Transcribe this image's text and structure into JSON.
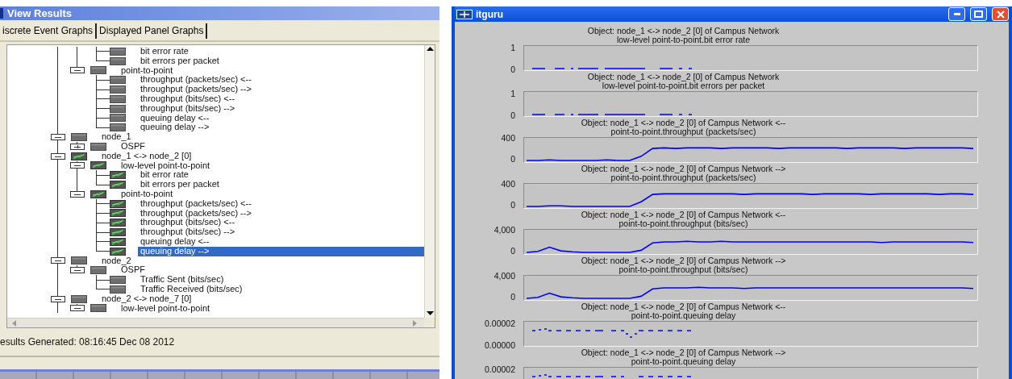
{
  "results_window": {
    "title": "View Results"
  },
  "tabs": [
    {
      "label": "iscrete Event Graphs"
    },
    {
      "label": "Displayed Panel Graphs"
    }
  ],
  "tree": {
    "items": [
      {
        "children": [
          {
            "children": [
              {
                "label": "bit error rate",
                "plotted": false,
                "selected": false
              },
              {
                "label": "bit errors per packet",
                "plotted": false,
                "selected": false
              }
            ]
          },
          {
            "label": "point-to-point",
            "expanded": true,
            "plotted": false,
            "selected": false,
            "children": [
              {
                "label": "throughput (packets/sec) <--",
                "plotted": false,
                "selected": false
              },
              {
                "label": "throughput (packets/sec) -->",
                "plotted": false,
                "selected": false
              },
              {
                "label": "throughput (bits/sec) <--",
                "plotted": false,
                "selected": false
              },
              {
                "label": "throughput (bits/sec) -->",
                "plotted": false,
                "selected": false
              },
              {
                "label": "queuing delay <--",
                "plotted": false,
                "selected": false
              },
              {
                "label": "queuing delay -->",
                "plotted": false,
                "selected": false
              }
            ]
          }
        ]
      },
      {
        "label": "node_1",
        "expanded": true,
        "plotted": false,
        "selected": false,
        "children": [
          {
            "label": "OSPF",
            "expanded": false,
            "plotted": false,
            "selected": false
          }
        ]
      },
      {
        "label": "node_1 <-> node_2 [0]",
        "expanded": true,
        "plotted": true,
        "selected": false,
        "children": [
          {
            "label": "low-level point-to-point",
            "expanded": true,
            "plotted": true,
            "selected": false,
            "children": [
              {
                "label": "bit error rate",
                "plotted": true,
                "selected": false
              },
              {
                "label": "bit errors per packet",
                "plotted": true,
                "selected": false
              }
            ]
          },
          {
            "label": "point-to-point",
            "expanded": true,
            "plotted": true,
            "selected": false,
            "children": [
              {
                "label": "throughput (packets/sec) <--",
                "plotted": true,
                "selected": false
              },
              {
                "label": "throughput (packets/sec) -->",
                "plotted": true,
                "selected": false
              },
              {
                "label": "throughput (bits/sec) <--",
                "plotted": true,
                "selected": false
              },
              {
                "label": "throughput (bits/sec) -->",
                "plotted": true,
                "selected": false
              },
              {
                "label": "queuing delay <--",
                "plotted": true,
                "selected": false
              },
              {
                "label": "queuing delay -->",
                "plotted": true,
                "selected": true
              }
            ]
          }
        ]
      },
      {
        "label": "node_2",
        "expanded": true,
        "plotted": false,
        "selected": false,
        "children": [
          {
            "label": "OSPF",
            "expanded": true,
            "plotted": false,
            "selected": false,
            "children": [
              {
                "label": "Traffic Sent (bits/sec)",
                "plotted": false,
                "selected": false
              },
              {
                "label": "Traffic Received (bits/sec)",
                "plotted": false,
                "selected": false
              }
            ]
          }
        ]
      },
      {
        "label": "node_2 <-> node_7 [0]",
        "expanded": true,
        "plotted": false,
        "selected": false,
        "children": [
          {
            "label": "low-level point-to-point",
            "expanded": true,
            "plotted": false,
            "selected": false
          }
        ]
      }
    ]
  },
  "status": "esults Generated: 08:16:45 Dec 08 2012",
  "graph_window": {
    "title": "itguru"
  },
  "graphs": [
    {
      "kind": "flat",
      "object_line": "Object: node_1 <-> node_2 [0] of Campus Network",
      "stat_line": "low-level point-to-point.bit error rate",
      "axis_labels": [
        "1",
        "0"
      ]
    },
    {
      "kind": "flat",
      "object_line": "Object: node_1 <-> node_2 [0] of Campus Network",
      "stat_line": "low-level point-to-point.bit errors per packet",
      "axis_labels": [
        "1",
        "0"
      ]
    },
    {
      "kind": "chart",
      "object_line": "Object: node_1 <-> node_2 [0] of Campus Network <--",
      "stat_line": "point-to-point.throughput (packets/sec)",
      "chart_data": {
        "type": "line",
        "ylim": [
          -46,
          446
        ],
        "yticks": [
          {
            "value": 400,
            "label": "400"
          },
          {
            "value": 0,
            "label": "0"
          }
        ],
        "series": [
          {
            "color": "#0000ff",
            "values": [
              0,
              0,
              10,
              0,
              0,
              0,
              0,
              10,
              0,
              0,
              80,
              230,
              240,
              230,
              240,
              240,
              240,
              230,
              240,
              240,
              240,
              240,
              230,
              240,
              240,
              240,
              240,
              240,
              230,
              240,
              240,
              240,
              240,
              230,
              240,
              240,
              240,
              240,
              240,
              230
            ]
          }
        ]
      }
    },
    {
      "kind": "chart",
      "object_line": "Object: node_1 <-> node_2 [0] of Campus Network -->",
      "stat_line": "point-to-point.throughput (packets/sec)",
      "chart_data": {
        "type": "line",
        "ylim": [
          -46,
          446
        ],
        "yticks": [
          {
            "value": 400,
            "label": "400"
          },
          {
            "value": 0,
            "label": "0"
          }
        ],
        "series": [
          {
            "color": "#0000ff",
            "values": [
              0,
              0,
              10,
              10,
              0,
              0,
              0,
              0,
              0,
              0,
              90,
              230,
              240,
              240,
              240,
              240,
              240,
              240,
              240,
              230,
              240,
              240,
              240,
              240,
              240,
              230,
              240,
              240,
              240,
              240,
              230,
              240,
              240,
              240,
              240,
              240,
              230,
              240,
              240,
              230
            ]
          }
        ]
      }
    },
    {
      "kind": "chart",
      "object_line": "Object: node_1 <-> node_2 [0] of Campus Network <--",
      "stat_line": "point-to-point.throughput (bits/sec)",
      "chart_data": {
        "type": "line",
        "ylim": [
          -460,
          4460
        ],
        "yticks": [
          {
            "value": 4000,
            "label": "4,000"
          },
          {
            "value": 0,
            "label": "0"
          }
        ],
        "series": [
          {
            "color": "#0000ff",
            "values": [
              0,
              200,
              1000,
              300,
              100,
              0,
              0,
              0,
              0,
              0,
              400,
              1800,
              2000,
              2000,
              2100,
              2000,
              2000,
              2100,
              2000,
              2000,
              2000,
              2000,
              2000,
              2000,
              2000,
              2000,
              2000,
              2000,
              2000,
              2000,
              2000,
              1900,
              2000,
              2000,
              2000,
              2000,
              2000,
              2000,
              2000,
              1900
            ]
          }
        ]
      }
    },
    {
      "kind": "chart",
      "object_line": "Object: node_1 <-> node_2 [0] of Campus Network -->",
      "stat_line": "point-to-point.throughput (bits/sec)",
      "chart_data": {
        "type": "line",
        "ylim": [
          -460,
          4460
        ],
        "yticks": [
          {
            "value": 4000,
            "label": "4,000"
          },
          {
            "value": 0,
            "label": "0"
          }
        ],
        "series": [
          {
            "color": "#0000ff",
            "values": [
              0,
              200,
              1000,
              300,
              100,
              0,
              0,
              0,
              0,
              0,
              400,
              1800,
              2000,
              2000,
              2000,
              2100,
              2000,
              2000,
              2000,
              1900,
              2000,
              2000,
              2000,
              2000,
              2000,
              2000,
              2000,
              2000,
              2000,
              2000,
              2000,
              2000,
              2000,
              2000,
              2000,
              2000,
              2000,
              2000,
              2000,
              1900
            ]
          }
        ]
      }
    },
    {
      "kind": "dip",
      "object_line": "Object: node_1 <-> node_2 [0] of Campus Network <--",
      "stat_line": "point-to-point.queuing delay",
      "axis_labels": [
        "0.00002",
        "0.00000"
      ]
    },
    {
      "kind": "dip",
      "object_line": "Object: node_1 <-> node_2 [0] of Campus Network -->",
      "stat_line": "point-to-point.queuing delay",
      "axis_labels": [
        "0.00002"
      ]
    }
  ]
}
